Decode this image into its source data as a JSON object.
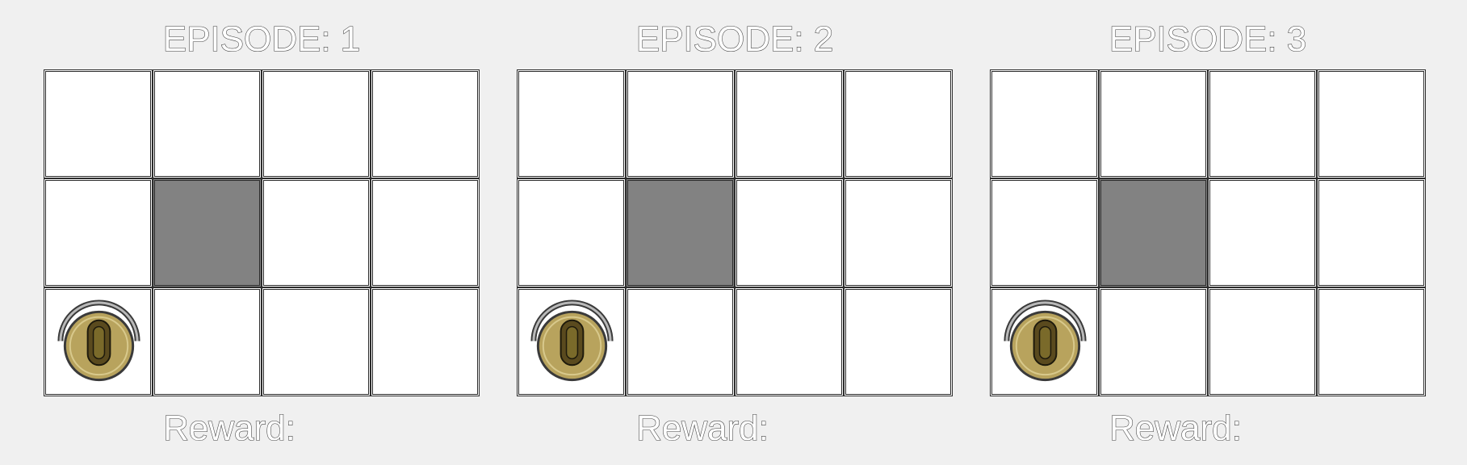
{
  "episodes": [
    {
      "title": "EPISODE: 1",
      "reward_label": "Reward:",
      "grid": {
        "rows": 3,
        "cols": 4,
        "walls": [
          [
            1,
            1
          ]
        ],
        "robot": [
          2,
          0
        ]
      }
    },
    {
      "title": "EPISODE: 2",
      "reward_label": "Reward:",
      "grid": {
        "rows": 3,
        "cols": 4,
        "walls": [
          [
            1,
            1
          ]
        ],
        "robot": [
          2,
          0
        ]
      }
    },
    {
      "title": "EPISODE: 3",
      "reward_label": "Reward:",
      "grid": {
        "rows": 3,
        "cols": 4,
        "walls": [
          [
            1,
            1
          ]
        ],
        "robot": [
          2,
          0
        ]
      }
    }
  ],
  "colors": {
    "background": "#f0f0f0",
    "cell": "#ffffff",
    "wall": "#828282",
    "robot_body": "#b8a35d",
    "robot_dark": "#5a4a1e"
  },
  "icons": {
    "robot": "robot-vacuum-icon"
  }
}
